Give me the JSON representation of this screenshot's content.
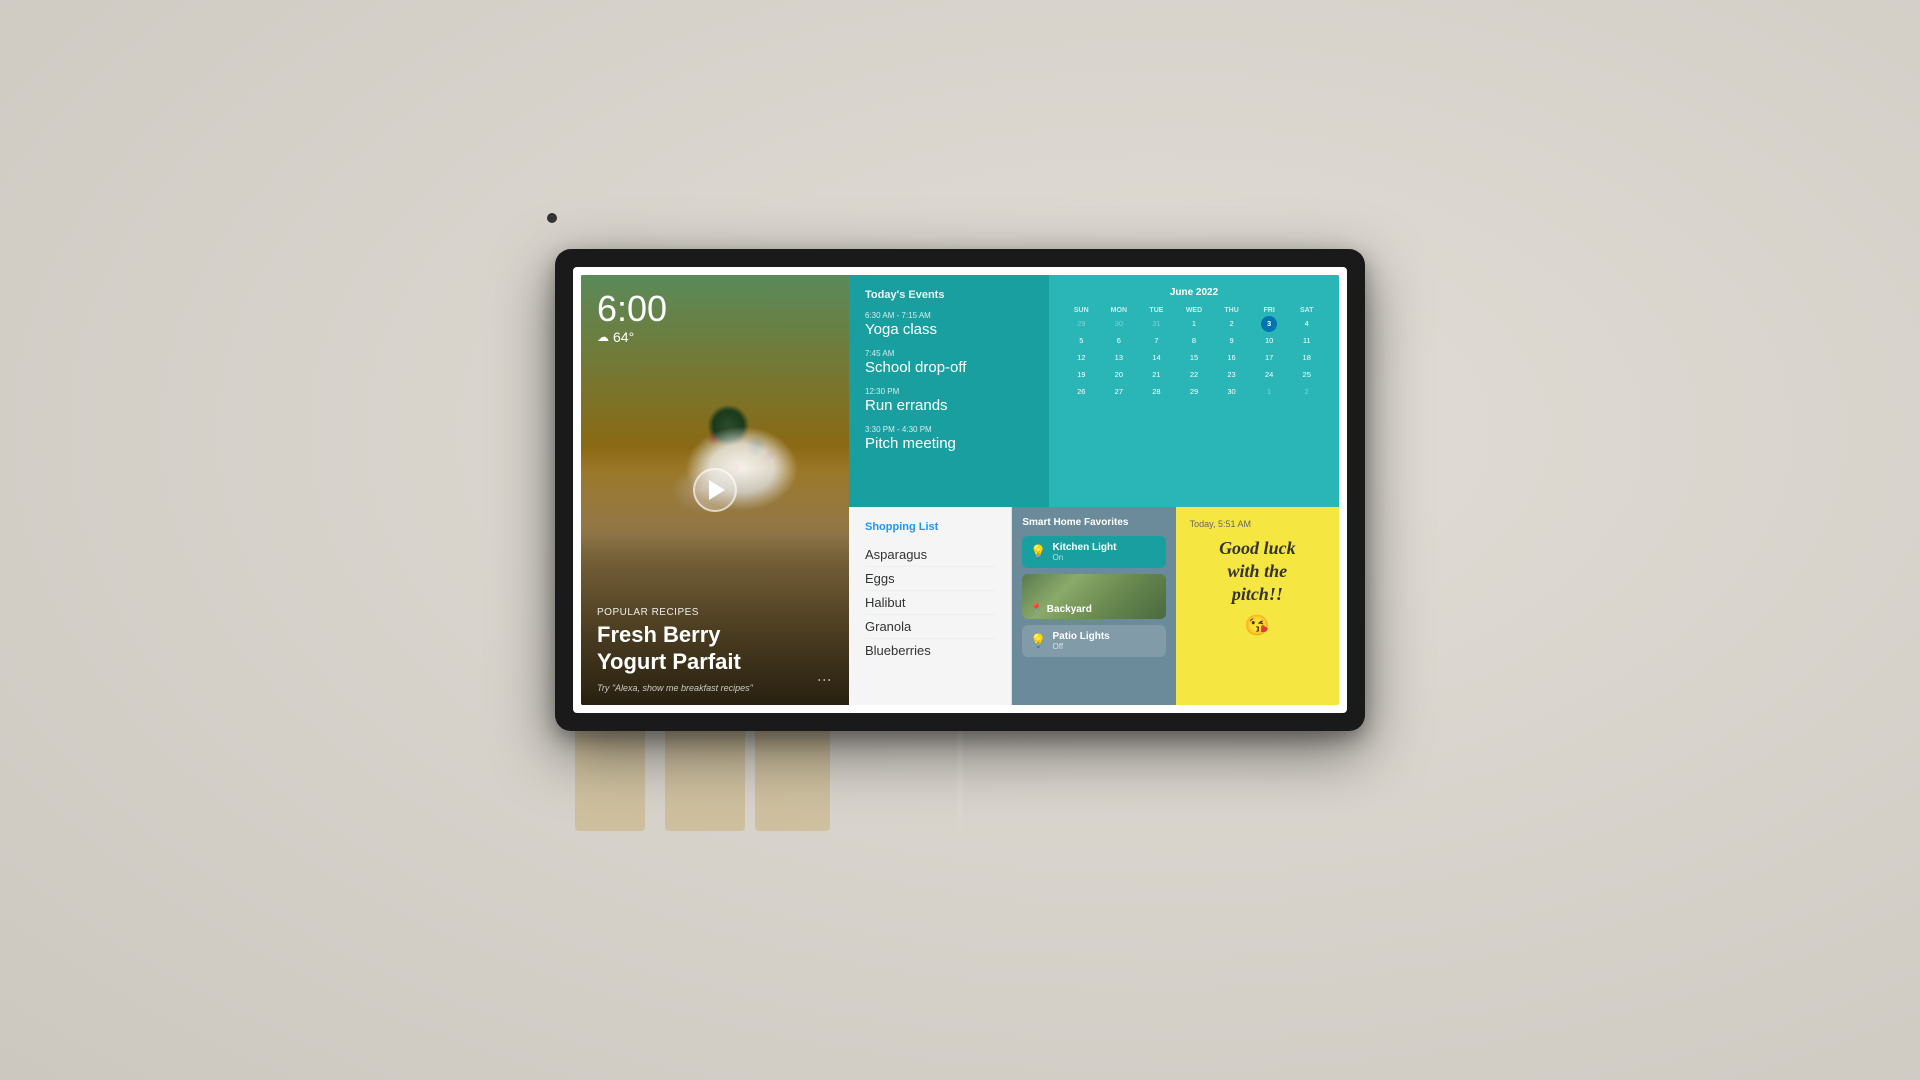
{
  "device": {
    "time": "6:00",
    "weather": {
      "icon": "☁",
      "temp": "64°"
    }
  },
  "recipe": {
    "label": "Popular Recipes",
    "title": "Fresh Berry\nYogurt Parfait",
    "hint": "Try \"Alexa, show me breakfast recipes\""
  },
  "events": {
    "section_title": "Today's Events",
    "items": [
      {
        "time": "6:30 AM - 7:15 AM",
        "name": "Yoga class"
      },
      {
        "time": "7:45 AM",
        "name": "School drop-off"
      },
      {
        "time": "12:30 PM",
        "name": "Run errands"
      },
      {
        "time": "3:30 PM - 4:30 PM",
        "name": "Pitch meeting"
      }
    ]
  },
  "calendar": {
    "title": "June 2022",
    "headers": [
      "SUN",
      "MON",
      "TUE",
      "WED",
      "THU",
      "FRI",
      "SAT"
    ],
    "weeks": [
      [
        "29",
        "30",
        "31",
        "1",
        "2",
        "3",
        "4"
      ],
      [
        "5",
        "6",
        "7",
        "8",
        "9",
        "10",
        "11"
      ],
      [
        "12",
        "13",
        "14",
        "15",
        "16",
        "17",
        "18"
      ],
      [
        "19",
        "20",
        "21",
        "22",
        "23",
        "24",
        "25"
      ],
      [
        "26",
        "27",
        "28",
        "29",
        "30",
        "1",
        "2"
      ]
    ],
    "today": "3",
    "today_col": 4
  },
  "shopping": {
    "title": "Shopping List",
    "items": [
      "Asparagus",
      "Eggs",
      "Halibut",
      "Granola",
      "Blueberries"
    ]
  },
  "smart_home": {
    "title": "Smart Home Favorites",
    "devices": [
      {
        "name": "Kitchen Light",
        "status": "On",
        "active": true,
        "icon": "💡"
      },
      {
        "name": "Backyard",
        "type": "image",
        "icon": "📍"
      },
      {
        "name": "Patio Lights",
        "status": "Off",
        "active": false,
        "icon": "💡"
      }
    ]
  },
  "sticky_note": {
    "time": "Today, 5:51 AM",
    "content": "Good luck\nwith the\npitch!!",
    "emoji": "😘"
  }
}
